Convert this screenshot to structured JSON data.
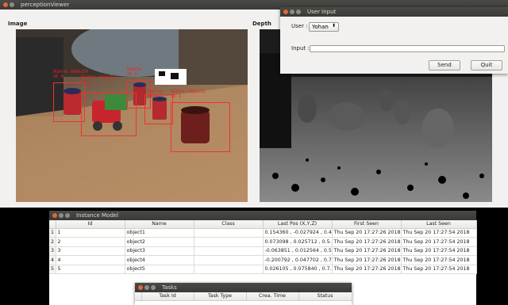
{
  "viewer": {
    "title": "perceptionViewer",
    "image_label": "Image",
    "depth_label": "Depth",
    "boxes": [
      {
        "label": "Name: object4\nid: 4"
      },
      {
        "label": "Name: object3\nid: 3"
      },
      {
        "label": "Name:\nid: 5"
      },
      {
        "label": "Name:\nid: 2"
      },
      {
        "label": "Name: object1\nid: 1"
      }
    ]
  },
  "user_input": {
    "title": "User Input",
    "user_label": "User :",
    "user_value": "Yohan",
    "input_label": "Input :",
    "input_value": "",
    "send_label": "Send",
    "quit_label": "Quit"
  },
  "instance_model": {
    "title": "Instance Model",
    "columns": [
      "Id",
      "Name",
      "Class",
      "Last Pos (X,Y,Z)",
      "First Seen",
      "Last Seen"
    ],
    "rows": [
      {
        "num": "1",
        "id": "1",
        "name": "object1",
        "class": "",
        "pos": "0.154360 , -0.027924 , 0.4...",
        "first": "Thu Sep 20 17:27:26 2018",
        "last": "Thu Sep 20 17:27:54 2018"
      },
      {
        "num": "2",
        "id": "2",
        "name": "object2",
        "class": "",
        "pos": "0.073098 , 0.025712 , 0.5...",
        "first": "Thu Sep 20 17:27:26 2018",
        "last": "Thu Sep 20 17:27:54 2018"
      },
      {
        "num": "3",
        "id": "3",
        "name": "object3",
        "class": "",
        "pos": "-0.063851 , 0.012564 , 0.5...",
        "first": "Thu Sep 20 17:27:26 2018",
        "last": "Thu Sep 20 17:27:54 2018"
      },
      {
        "num": "4",
        "id": "4",
        "name": "object4",
        "class": "",
        "pos": "-0.200792 , 0.047702 , 0.7...",
        "first": "Thu Sep 20 17:27:26 2018",
        "last": "Thu Sep 20 17:27:54 2018"
      },
      {
        "num": "5",
        "id": "5",
        "name": "object5",
        "class": "",
        "pos": "0.026105 , 0.075840 , 0.7...",
        "first": "Thu Sep 20 17:27:26 2018",
        "last": "Thu Sep 20 17:27:54 2018"
      }
    ]
  },
  "tasks": {
    "title": "Tasks",
    "columns": [
      "Task Id",
      "Task Type",
      "Crea. Time",
      "Status"
    ]
  },
  "colors": {
    "bbox": "#e33333",
    "titlebar": "#3c3b37",
    "close_button": "#e0663a"
  }
}
